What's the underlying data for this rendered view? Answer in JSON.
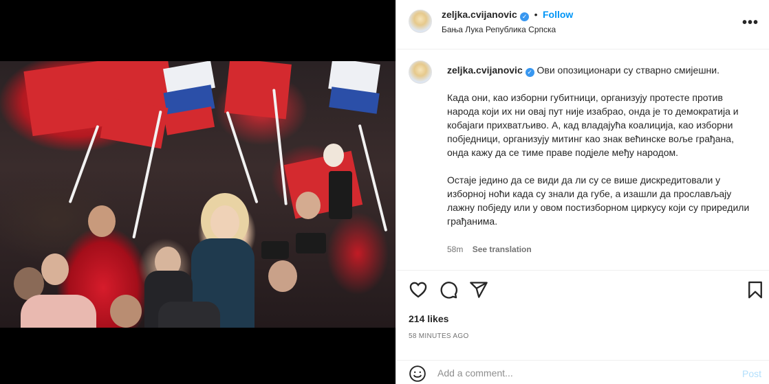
{
  "post": {
    "username": "zeljka.cvijanovic",
    "verified_icon": "verified-badge-icon",
    "follow_label": "Follow",
    "separator": "•",
    "location": "Бања Лука Република Српска",
    "more_icon": "more-options-icon",
    "more_label": "•••"
  },
  "caption": {
    "username": "zeljka.cvijanovic",
    "line1": "Ови опозиционари су стварно смијешни.",
    "para2": "Када они, као изборни губитници, организују протесте против народа који их ни овај пут није изабрао, онда је то демократија и кобајаги прихватљиво. А, кад владајућа коалиција, као изборни побједници, организују митинг као знак већинске воље грађана, онда кажу да се тиме праве подјеле међу народом.",
    "para3": "Остаје једино да се види да ли су се више дискредитовали у изборној ноћи када су знали да губе, а изашли да прослављају лажну побједу или у овом постизборном циркусу који су приредили грађанима.",
    "time": "58m",
    "see_translation": "See translation"
  },
  "actions": {
    "like_icon": "heart-icon",
    "comment_icon": "comment-icon",
    "share_icon": "share-icon",
    "save_icon": "bookmark-icon"
  },
  "stats": {
    "likes": "214 likes",
    "ago": "58 MINUTES AGO"
  },
  "comment": {
    "emoji_icon": "emoji-icon",
    "placeholder": "Add a comment...",
    "post_label": "Post"
  },
  "colors": {
    "accent": "#0095f6",
    "verified": "#3897f0",
    "post_disabled": "#b2dffc"
  }
}
